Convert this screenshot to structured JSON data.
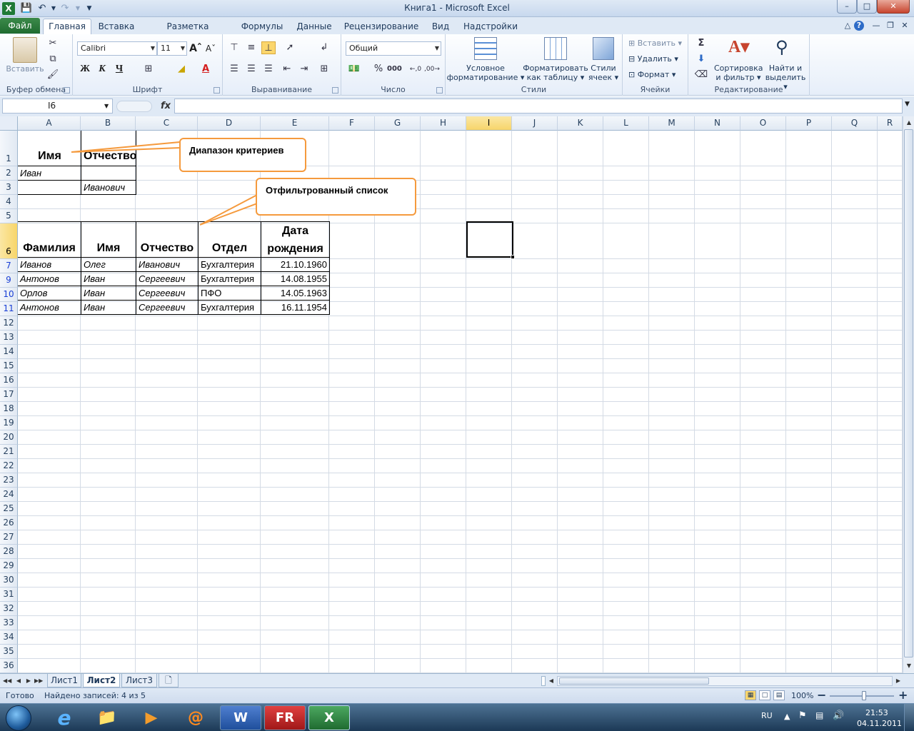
{
  "window": {
    "title": "Книга1  -  Microsoft Excel",
    "minimize": "–",
    "maximize": "□",
    "close": "✕"
  },
  "quick_access": {
    "excel_icon": "X",
    "save_icon": "save-icon",
    "undo_icon": "undo-icon",
    "redo_icon": "redo-icon"
  },
  "ribbon_tabs": [
    "Файл",
    "Главная",
    "Вставка",
    "Разметка страницы",
    "Формулы",
    "Данные",
    "Рецензирование",
    "Вид",
    "Надстройки"
  ],
  "ribbon": {
    "clipboard": {
      "group": "Буфер обмена",
      "paste": "Вставить"
    },
    "font": {
      "group": "Шрифт",
      "name": "Calibri",
      "size": "11",
      "bold": "Ж",
      "italic": "К",
      "underline": "Ч"
    },
    "alignment": {
      "group": "Выравнивание"
    },
    "number": {
      "group": "Число",
      "format": "Общий",
      "percent": "%",
      "thousands": "000"
    },
    "styles": {
      "group": "Стили",
      "conditional_1": "Условное",
      "conditional_2": "форматирование",
      "format_table_1": "Форматировать",
      "format_table_2": "как таблицу",
      "cell_styles_1": "Стили",
      "cell_styles_2": "ячеек"
    },
    "cells": {
      "group": "Ячейки",
      "insert": "Вставить",
      "delete": "Удалить",
      "format": "Формат"
    },
    "editing": {
      "group": "Редактирование",
      "sum": "Σ",
      "sort_1": "Сортировка",
      "sort_2": "и фильтр",
      "find_1": "Найти и",
      "find_2": "выделить"
    }
  },
  "formula_bar": {
    "name_box": "I6",
    "fx": "fx",
    "value": ""
  },
  "columns": [
    "A",
    "B",
    "C",
    "D",
    "E",
    "F",
    "G",
    "H",
    "I",
    "J",
    "K",
    "L",
    "M",
    "N",
    "O",
    "P",
    "Q",
    "R"
  ],
  "rows": [
    "1",
    "2",
    "3",
    "4",
    "5",
    "6",
    "7",
    "9",
    "10",
    "11",
    "12",
    "13",
    "14",
    "15",
    "16",
    "17",
    "18",
    "19",
    "20",
    "21",
    "22",
    "23",
    "24",
    "25",
    "26",
    "27",
    "28",
    "29",
    "30",
    "31",
    "32",
    "33",
    "34",
    "35",
    "36"
  ],
  "criteria": {
    "header_name": "Имя",
    "header_patronymic": "Отчество",
    "a2": "Иван",
    "b3": "Иванович"
  },
  "list_headers": {
    "surname": "Фамилия",
    "name": "Имя",
    "patronymic": "Отчество",
    "dept": "Отдел",
    "birth_1": "Дата",
    "birth_2": "рождения"
  },
  "list_rows": [
    {
      "surname": "Иванов",
      "name": "Олег",
      "patronymic": "Иванович",
      "dept": "Бухгалтерия",
      "date": "21.10.1960"
    },
    {
      "surname": "Антонов",
      "name": "Иван",
      "patronymic": "Сергеевич",
      "dept": "Бухгалтерия",
      "date": "14.08.1955"
    },
    {
      "surname": "Орлов",
      "name": "Иван",
      "patronymic": "Сергеевич",
      "dept": "ПФО",
      "date": "14.05.1963"
    },
    {
      "surname": "Антонов",
      "name": "Иван",
      "patronymic": "Сергеевич",
      "dept": "Бухгалтерия",
      "date": "16.11.1954"
    }
  ],
  "callouts": {
    "criteria_range": "Диапазон критериев",
    "filtered_list": "Отфильтрованный список"
  },
  "sheet_tabs": [
    "Лист1",
    "Лист2",
    "Лист3"
  ],
  "status": {
    "ready": "Готово",
    "records": "Найдено записей: 4 из 5",
    "zoom": "100%",
    "zoom_out": "−",
    "zoom_in": "+"
  },
  "taskbar": {
    "lang": "RU",
    "time": "21:53",
    "date": "04.11.2011",
    "word_label": "W",
    "excel_label": "X",
    "fr_label": "FR"
  },
  "colors": {
    "accent_orange": "#f59a3d",
    "file_tab_green": "#1f6b30",
    "selected_header": "#f7d56a",
    "filtered_row_number": "#1a3fd6"
  }
}
